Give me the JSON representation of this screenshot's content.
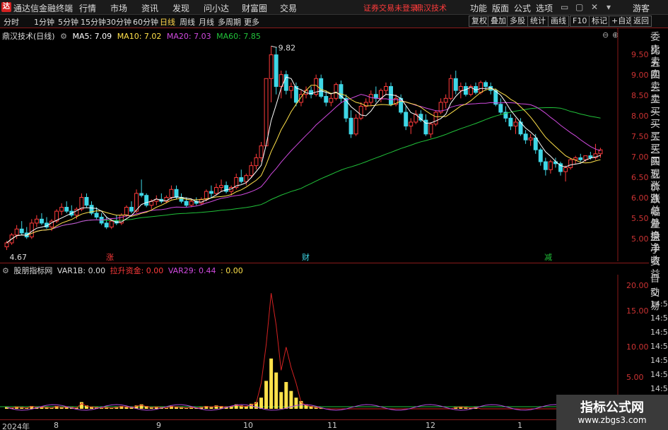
{
  "app": {
    "title": "通达信金融终端"
  },
  "menu": [
    "行情",
    "市场",
    "资讯",
    "发现",
    "问小达",
    "财富圈",
    "交易"
  ],
  "notice": {
    "login": "证券交易未登录",
    "brand": "鼎汉技术"
  },
  "system": [
    "功能",
    "版面",
    "公式",
    "选项",
    "游客"
  ],
  "periods": [
    "分时",
    "1分钟",
    "5分钟",
    "15分钟",
    "30分钟",
    "60分钟",
    "日线",
    "周线",
    "月线",
    "多周期",
    "更多"
  ],
  "active_period": "日线",
  "tool_buttons": [
    "复权",
    "叠加",
    "多股",
    "统计",
    "画线",
    "F10",
    "标记",
    "+自选",
    "返回"
  ],
  "main": {
    "title": "鼎汉技术(日线)",
    "ma5": "MA5: 7.09",
    "ma10": "MA10: 7.02",
    "ma20": "MA20: 7.03",
    "ma60": "MA60: 7.85",
    "high_label": "9.82",
    "low_label": "4.67",
    "markers": [
      "涨",
      "财",
      "减"
    ],
    "axis": [
      "9.50",
      "9.00",
      "8.50",
      "8.00",
      "7.50",
      "7.00",
      "6.50",
      "6.00",
      "5.50",
      "5.00"
    ]
  },
  "quote_panel": [
    "委比",
    "卖五",
    "卖四",
    "卖三",
    "卖二",
    "卖一",
    "买一",
    "买二",
    "买三",
    "买四",
    "买五",
    "现价",
    "涨跌",
    "涨幅",
    "总量",
    "外盘",
    "换手",
    "净资",
    "收益"
  ],
  "indicator": {
    "name": "股朋指标网",
    "var1b": "VAR1B: 0.00",
    "fund": "拉升资金: 0.00",
    "var29": "VAR29: 0.44",
    "extra": ": 0.00",
    "axis": [
      "20.00",
      "15.00",
      "10.00",
      "5.00"
    ]
  },
  "right_lower": [
    "自动",
    "交易",
    "14:56",
    "14:56",
    "14:56",
    "14:56",
    "14:56",
    "14:56",
    "14:56",
    "14:56"
  ],
  "dates": [
    "2024年",
    "8",
    "9",
    "10",
    "11",
    "12",
    "1"
  ],
  "watermark": {
    "line1": "指标公式网",
    "line2": "www.zbgs3.com"
  },
  "colors": {
    "up": "#ff3b3b",
    "down": "#3fd7e6",
    "ma5": "#ffffff",
    "ma10": "#ffe14a",
    "ma20": "#d04adf",
    "ma60": "#21c23a",
    "bar": "#ffe14a"
  },
  "chart_data": {
    "type": "candlestick",
    "ohlc": [
      [
        4.75,
        4.9,
        4.67,
        4.85
      ],
      [
        4.85,
        5.1,
        4.8,
        5.05
      ],
      [
        5.05,
        5.3,
        4.95,
        5.2
      ],
      [
        5.2,
        5.4,
        5.05,
        5.1
      ],
      [
        5.1,
        5.25,
        4.95,
        5.0
      ],
      [
        5.0,
        5.45,
        4.95,
        5.35
      ],
      [
        5.35,
        5.55,
        5.25,
        5.45
      ],
      [
        5.45,
        5.6,
        5.3,
        5.35
      ],
      [
        5.35,
        5.5,
        5.2,
        5.25
      ],
      [
        5.25,
        5.45,
        5.15,
        5.4
      ],
      [
        5.4,
        5.7,
        5.35,
        5.65
      ],
      [
        5.65,
        5.85,
        5.55,
        5.75
      ],
      [
        5.75,
        5.9,
        5.6,
        5.65
      ],
      [
        5.65,
        5.8,
        5.5,
        5.55
      ],
      [
        5.55,
        5.75,
        5.45,
        5.7
      ],
      [
        5.7,
        6.1,
        5.65,
        6.0
      ],
      [
        6.0,
        6.1,
        5.75,
        5.8
      ],
      [
        5.8,
        5.9,
        5.55,
        5.6
      ],
      [
        5.6,
        5.75,
        5.45,
        5.5
      ],
      [
        5.5,
        5.6,
        5.3,
        5.35
      ],
      [
        5.35,
        5.5,
        5.2,
        5.25
      ],
      [
        5.25,
        5.45,
        5.2,
        5.4
      ],
      [
        5.4,
        5.55,
        5.3,
        5.35
      ],
      [
        5.35,
        5.6,
        5.3,
        5.55
      ],
      [
        5.55,
        5.8,
        5.5,
        5.75
      ],
      [
        5.75,
        5.9,
        5.6,
        5.65
      ],
      [
        5.65,
        6.2,
        5.6,
        6.1
      ],
      [
        6.1,
        6.45,
        6.0,
        6.05
      ],
      [
        6.05,
        6.1,
        5.75,
        5.8
      ],
      [
        5.8,
        5.95,
        5.7,
        5.9
      ],
      [
        5.9,
        6.05,
        5.8,
        5.95
      ],
      [
        5.95,
        6.1,
        5.85,
        5.9
      ],
      [
        5.9,
        6.05,
        5.85,
        6.0
      ],
      [
        6.0,
        6.3,
        5.95,
        6.2
      ],
      [
        6.2,
        6.3,
        5.95,
        6.0
      ],
      [
        6.0,
        6.1,
        5.85,
        5.9
      ],
      [
        5.9,
        6.0,
        5.75,
        5.8
      ],
      [
        5.8,
        5.95,
        5.75,
        5.9
      ],
      [
        5.9,
        6.0,
        5.8,
        5.85
      ],
      [
        5.85,
        6.0,
        5.8,
        5.95
      ],
      [
        5.95,
        6.2,
        5.9,
        6.15
      ],
      [
        6.15,
        6.3,
        6.0,
        6.1
      ],
      [
        6.1,
        6.35,
        6.05,
        6.25
      ],
      [
        6.25,
        6.45,
        6.15,
        6.3
      ],
      [
        6.3,
        6.4,
        6.1,
        6.15
      ],
      [
        6.15,
        6.3,
        6.05,
        6.25
      ],
      [
        6.25,
        6.6,
        6.2,
        6.5
      ],
      [
        6.5,
        6.7,
        6.35,
        6.4
      ],
      [
        6.4,
        6.6,
        6.3,
        6.55
      ],
      [
        6.55,
        6.9,
        6.5,
        6.8
      ],
      [
        6.8,
        7.1,
        6.7,
        7.0
      ],
      [
        7.0,
        7.4,
        6.9,
        7.3
      ],
      [
        7.3,
        9.0,
        7.3,
        9.0
      ],
      [
        9.0,
        9.82,
        8.4,
        9.6
      ],
      [
        9.6,
        9.8,
        8.6,
        8.8
      ],
      [
        8.8,
        9.2,
        8.5,
        9.1
      ],
      [
        9.1,
        9.2,
        8.6,
        8.7
      ],
      [
        8.7,
        8.9,
        8.5,
        8.8
      ],
      [
        8.8,
        8.9,
        8.3,
        8.4
      ],
      [
        8.4,
        8.7,
        8.3,
        8.6
      ],
      [
        8.6,
        8.8,
        8.5,
        8.7
      ],
      [
        8.7,
        8.8,
        8.5,
        8.6
      ],
      [
        8.6,
        9.1,
        8.55,
        9.0
      ],
      [
        9.0,
        9.1,
        8.5,
        8.55
      ],
      [
        8.55,
        8.7,
        8.3,
        8.4
      ],
      [
        8.4,
        8.6,
        8.3,
        8.5
      ],
      [
        8.5,
        8.9,
        8.45,
        8.85
      ],
      [
        8.85,
        8.95,
        8.4,
        8.5
      ],
      [
        8.5,
        8.6,
        7.9,
        8.0
      ],
      [
        8.0,
        8.2,
        7.5,
        7.6
      ],
      [
        7.6,
        8.1,
        7.55,
        8.0
      ],
      [
        8.0,
        8.4,
        7.95,
        8.3
      ],
      [
        8.3,
        8.5,
        8.2,
        8.4
      ],
      [
        8.4,
        8.7,
        8.3,
        8.6
      ],
      [
        8.6,
        8.8,
        8.4,
        8.5
      ],
      [
        8.5,
        8.75,
        8.4,
        8.7
      ],
      [
        8.7,
        8.9,
        8.6,
        8.8
      ],
      [
        8.8,
        8.9,
        8.3,
        8.35
      ],
      [
        8.35,
        8.6,
        8.3,
        8.5
      ],
      [
        8.5,
        8.6,
        8.1,
        8.15
      ],
      [
        8.15,
        8.3,
        7.7,
        7.8
      ],
      [
        7.8,
        8.0,
        7.6,
        7.9
      ],
      [
        7.9,
        8.2,
        7.85,
        8.1
      ],
      [
        8.1,
        8.2,
        7.9,
        7.95
      ],
      [
        7.95,
        8.1,
        7.55,
        7.6
      ],
      [
        7.6,
        7.9,
        7.5,
        7.85
      ],
      [
        7.85,
        8.2,
        7.8,
        8.15
      ],
      [
        8.15,
        8.5,
        8.1,
        8.4
      ],
      [
        8.4,
        8.6,
        8.25,
        8.5
      ],
      [
        8.5,
        9.1,
        8.45,
        9.0
      ],
      [
        9.0,
        9.2,
        8.6,
        8.7
      ],
      [
        8.7,
        8.9,
        8.5,
        8.8
      ],
      [
        8.8,
        8.9,
        8.55,
        8.6
      ],
      [
        8.6,
        8.85,
        8.55,
        8.8
      ],
      [
        8.8,
        8.9,
        8.6,
        8.65
      ],
      [
        8.65,
        8.95,
        8.6,
        8.9
      ],
      [
        8.9,
        8.95,
        8.7,
        8.8
      ],
      [
        8.8,
        8.9,
        8.6,
        8.7
      ],
      [
        8.7,
        8.75,
        8.3,
        8.35
      ],
      [
        8.35,
        8.5,
        8.1,
        8.15
      ],
      [
        8.15,
        8.3,
        7.9,
        8.0
      ],
      [
        8.0,
        8.1,
        7.7,
        7.8
      ],
      [
        7.8,
        8.0,
        7.6,
        7.9
      ],
      [
        7.9,
        8.0,
        7.55,
        7.6
      ],
      [
        7.6,
        7.7,
        7.35,
        7.45
      ],
      [
        7.45,
        7.6,
        7.3,
        7.5
      ],
      [
        7.5,
        7.6,
        7.1,
        7.2
      ],
      [
        7.2,
        7.25,
        6.8,
        6.9
      ],
      [
        6.9,
        7.0,
        6.55,
        6.7
      ],
      [
        6.7,
        6.95,
        6.6,
        6.9
      ],
      [
        6.9,
        7.0,
        6.75,
        6.85
      ],
      [
        6.85,
        6.9,
        6.55,
        6.65
      ],
      [
        6.65,
        6.8,
        6.4,
        6.75
      ],
      [
        6.75,
        7.0,
        6.7,
        6.95
      ],
      [
        6.95,
        7.05,
        6.85,
        7.0
      ],
      [
        7.0,
        7.1,
        6.9,
        6.95
      ],
      [
        6.95,
        7.05,
        6.9,
        7.05
      ],
      [
        7.05,
        7.15,
        6.95,
        7.0
      ],
      [
        7.0,
        7.35,
        6.95,
        7.1
      ],
      [
        7.1,
        7.25,
        7.0,
        7.2
      ]
    ],
    "price_range": [
      4.6,
      9.95
    ],
    "indicator_bars": [
      0.3,
      0.2,
      0.4,
      0.3,
      0.2,
      0.5,
      0.3,
      0.4,
      0.3,
      0.2,
      0.5,
      0.3,
      0.4,
      0.3,
      0.2,
      1.2,
      0.6,
      0.4,
      0.3,
      0.2,
      0.3,
      0.2,
      0.3,
      0.5,
      0.4,
      0.3,
      0.6,
      0.8,
      0.5,
      0.3,
      0.4,
      0.3,
      0.2,
      0.5,
      0.4,
      0.3,
      0.2,
      0.3,
      0.2,
      0.3,
      0.5,
      0.4,
      0.6,
      0.5,
      0.4,
      0.5,
      0.8,
      0.6,
      0.5,
      0.9,
      1.2,
      2.0,
      5.0,
      9.0,
      6.5,
      3.0,
      4.8,
      3.2,
      2.0,
      1.4,
      0.8,
      0.5,
      0.3,
      0.2,
      0,
      0,
      0,
      0,
      0,
      0,
      0,
      0,
      0,
      0,
      0,
      0,
      0,
      0,
      0,
      0,
      0,
      0,
      0,
      0,
      0,
      0,
      0,
      0,
      0,
      0,
      0.3,
      0.4,
      0.3,
      0.2,
      0.3,
      0,
      0,
      0,
      0,
      0,
      0,
      0,
      0,
      0,
      0,
      0,
      0,
      0,
      0,
      0,
      0,
      0,
      0,
      0,
      0,
      0,
      0,
      0,
      0,
      0
    ],
    "indicator_range": [
      0,
      23
    ]
  }
}
